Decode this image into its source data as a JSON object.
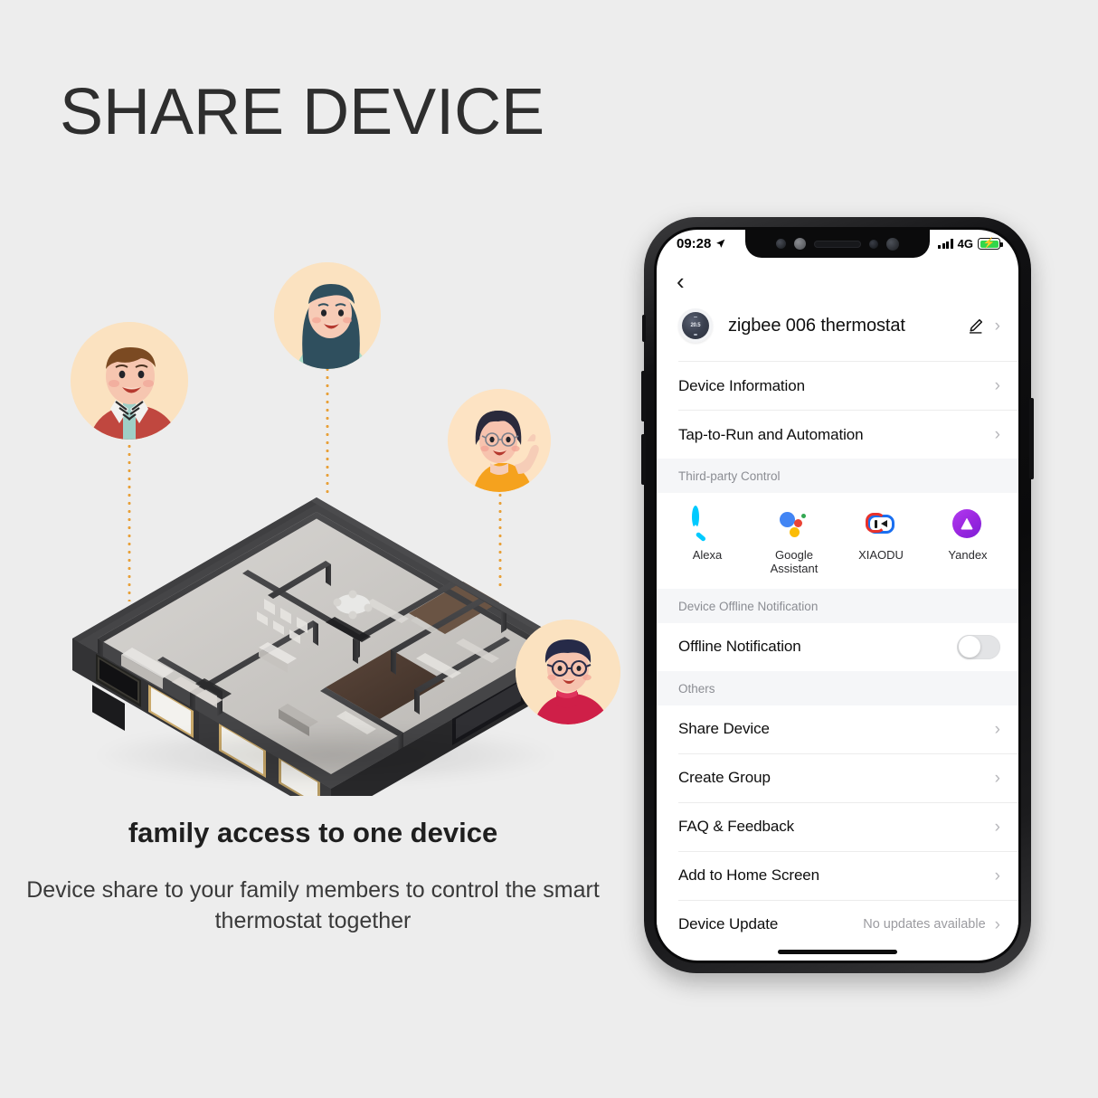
{
  "headline": "SHARE DEVICE",
  "caption": {
    "title": "family access to one device",
    "subtitle": "Device share to your family members to control the smart thermostat together"
  },
  "illustration": {
    "house_name": "isometric-floor-plan",
    "avatars": [
      {
        "name": "avatar-man-red-jacket",
        "hair": "#7b4a22",
        "skin": "#f6c6b0",
        "cloth": "#c0473f",
        "bg": "#fbe2c0"
      },
      {
        "name": "avatar-woman-mint",
        "hair": "#2f4f5e",
        "skin": "#f7cbb6",
        "cloth": "#a9dcc8",
        "bg": "#fbe2c0"
      },
      {
        "name": "avatar-woman-orange-wave",
        "hair": "#2a2a3c",
        "skin": "#f7c3ae",
        "cloth": "#f5a21e",
        "bg": "#fde3c3"
      },
      {
        "name": "avatar-person-crimson",
        "hair": "#262a48",
        "skin": "#f6c3ae",
        "cloth": "#cf1f48",
        "bg": "#fbe2c0"
      }
    ]
  },
  "phone": {
    "status_bar": {
      "time": "09:28",
      "location_icon": "location-arrow-icon",
      "signal_icon": "signal-bars-icon",
      "network": "4G",
      "battery_icon": "battery-charging-icon"
    },
    "nav": {
      "back_icon": "chevron-left-icon"
    },
    "device": {
      "thumb_icon": "thermostat-dial-icon",
      "thumb_temp": "20.5",
      "name": "zigbee 006 thermostat",
      "edit_icon": "pencil-edit-icon",
      "chevron": "›"
    },
    "sections": [
      {
        "header": null,
        "rows": [
          {
            "label": "Device Information",
            "value": null,
            "control": "chevron"
          },
          {
            "label": "Tap-to-Run and Automation",
            "value": null,
            "control": "chevron"
          }
        ]
      },
      {
        "header": "Third-party Control",
        "type": "icons",
        "items": [
          {
            "label": "Alexa",
            "icon": "alexa-icon",
            "color": "#00caff"
          },
          {
            "label": "Google Assistant",
            "icon": "google-assistant-icon",
            "color": "#4285f4"
          },
          {
            "label": "XIAODU",
            "icon": "xiaodu-icon",
            "color": "#1a6ff0"
          },
          {
            "label": "Yandex",
            "icon": "yandex-icon",
            "color": "#9b27e0"
          }
        ]
      },
      {
        "header": "Device Offline Notification",
        "rows": [
          {
            "label": "Offline Notification",
            "value": null,
            "control": "toggle",
            "toggle_on": false
          }
        ]
      },
      {
        "header": "Others",
        "rows": [
          {
            "label": "Share Device",
            "value": null,
            "control": "chevron"
          },
          {
            "label": "Create Group",
            "value": null,
            "control": "chevron"
          },
          {
            "label": "FAQ & Feedback",
            "value": null,
            "control": "chevron"
          },
          {
            "label": "Add to Home Screen",
            "value": null,
            "control": "chevron"
          },
          {
            "label": "Device Update",
            "value": "No updates available",
            "control": "chevron"
          }
        ]
      }
    ]
  },
  "colors": {
    "background": "#ededed",
    "accent_dotline": "#e8a13a",
    "toggle_off_track": "#e3e4e6",
    "battery_green": "#32d74b"
  }
}
